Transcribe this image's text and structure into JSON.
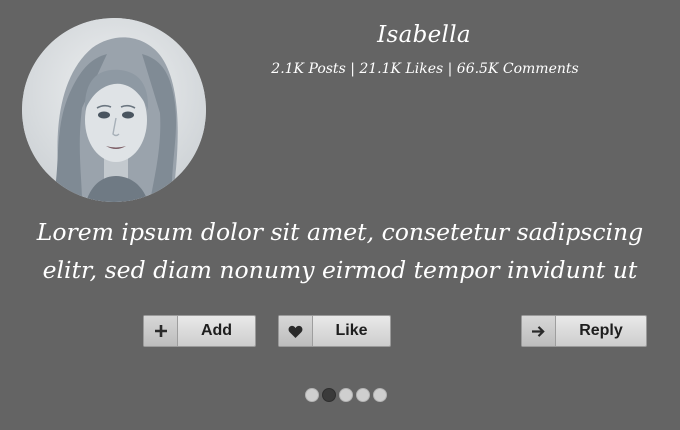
{
  "profile": {
    "name": "Isabella",
    "stats": "2.1K Posts | 21.1K Likes | 66.5K Comments"
  },
  "quote": "Lorem ipsum dolor sit amet, consetetur sadipscing elitr, sed diam nonumy eirmod tempor invidunt ut",
  "actions": {
    "add": {
      "icon": "plus-icon",
      "label": "Add"
    },
    "like": {
      "icon": "heart-icon",
      "label": "Like"
    },
    "reply": {
      "icon": "arrow-right-icon",
      "label": "Reply"
    }
  },
  "pagination": {
    "count": 5,
    "active_index": 1
  },
  "colors": {
    "background": "#646464",
    "text": "#ffffff",
    "button": "#dcdcdc",
    "dot": "#cfcfcf",
    "dot_active": "#3a3a3a"
  }
}
